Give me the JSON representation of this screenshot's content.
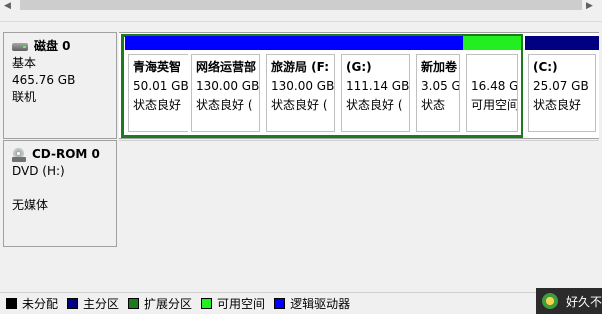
{
  "disk0": {
    "title": "磁盘 0",
    "type": "基本",
    "size": "465.76 GB",
    "status": "联机"
  },
  "cdrom": {
    "title": "CD-ROM 0",
    "drive": "DVD (H:)",
    "media": "无媒体"
  },
  "partitions": [
    {
      "name": "青海英智",
      "size": "50.01 GB",
      "status": "状态良好",
      "bar_color": "#0000ff"
    },
    {
      "name": "网络运营部",
      "size": "130.00 GB",
      "status": "状态良好 (",
      "bar_color": "#0000ff"
    },
    {
      "name": "旅游局 (F:",
      "size": "130.00 GB",
      "status": "状态良好 (",
      "bar_color": "#0000ff"
    },
    {
      "name": "(G:)",
      "size": "111.14 GB",
      "status": "状态良好 (",
      "bar_color": "#0000ff"
    },
    {
      "name": "新加卷",
      "size": "3.05 G",
      "status": "状态",
      "bar_color": "#0000ff"
    },
    {
      "name": "",
      "size": "16.48 G",
      "status": "可用空间",
      "bar_color": "#22ee22"
    },
    {
      "name": "(C:)",
      "size": "25.07 GB",
      "status": "状态良好",
      "bar_color": "#000080"
    }
  ],
  "legend": [
    {
      "label": "未分配",
      "color": "#000000"
    },
    {
      "label": "主分区",
      "color": "#000080"
    },
    {
      "label": "扩展分区",
      "color": "#1e7a1e"
    },
    {
      "label": "可用空间",
      "color": "#22ee22"
    },
    {
      "label": "逻辑驱动器",
      "color": "#0000ff"
    }
  ],
  "toast": {
    "text": "好久不"
  },
  "colors": {
    "extended_border": "#1e7a1e"
  }
}
